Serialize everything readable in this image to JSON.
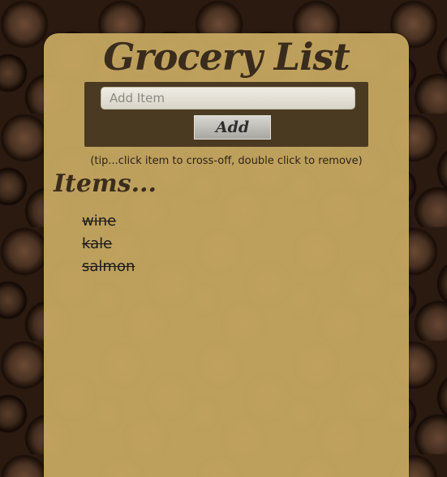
{
  "app": {
    "title": "Grocery List"
  },
  "add_form": {
    "placeholder": "Add Item",
    "value": "",
    "button_label": "Add"
  },
  "tip": "(tip...click item to cross-off, double click to remove)",
  "list": {
    "heading": "Items...",
    "items": [
      {
        "label": "wine",
        "crossed_off": true
      },
      {
        "label": "kale",
        "crossed_off": true
      },
      {
        "label": "salmon",
        "crossed_off": true
      }
    ]
  },
  "colors": {
    "card_background": "#c4a660",
    "panel_background": "#4a3a22",
    "heading_text": "#3a2c1c"
  }
}
